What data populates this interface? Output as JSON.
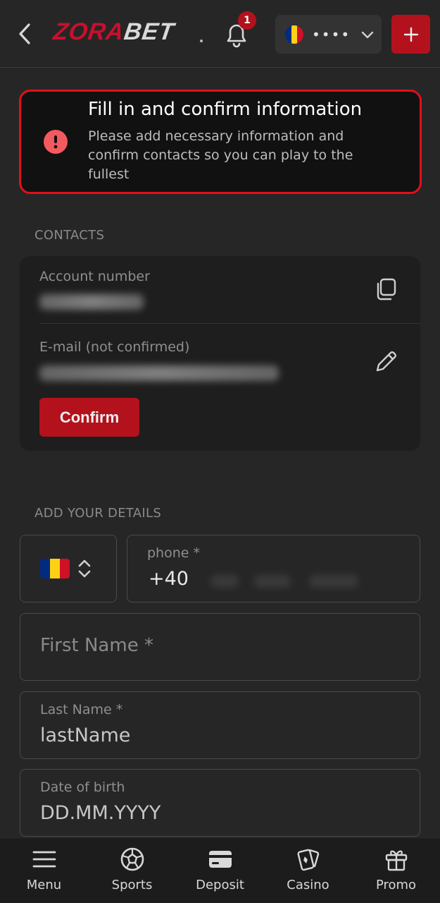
{
  "header": {
    "logo_part1": "ZORA",
    "logo_part2": "BET",
    "notification_count": "1",
    "balance_masked": "••••",
    "brand_color": "#c8102e"
  },
  "alert": {
    "title": "Fill in and confirm information",
    "text": "Please add necessary information and confirm contacts so you can play to the fullest"
  },
  "contacts": {
    "section_label": "CONTACTS",
    "account_label": "Account number",
    "email_label": "E-mail (not confirmed)",
    "confirm_label": "Confirm"
  },
  "details": {
    "section_label": "ADD YOUR DETAILS",
    "phone_label": "phone *",
    "phone_prefix": "+40",
    "first_name_placeholder": "First Name *",
    "last_name_label": "Last Name *",
    "last_name_value": "lastName",
    "dob_label": "Date of birth",
    "dob_placeholder": "DD.MM.YYYY"
  },
  "nav": {
    "items": [
      {
        "label": "Menu",
        "icon": "menu-icon"
      },
      {
        "label": "Sports",
        "icon": "soccer-ball-icon"
      },
      {
        "label": "Deposit",
        "icon": "wallet-icon"
      },
      {
        "label": "Casino",
        "icon": "cards-icon"
      },
      {
        "label": "Promo",
        "icon": "gift-icon"
      }
    ]
  }
}
